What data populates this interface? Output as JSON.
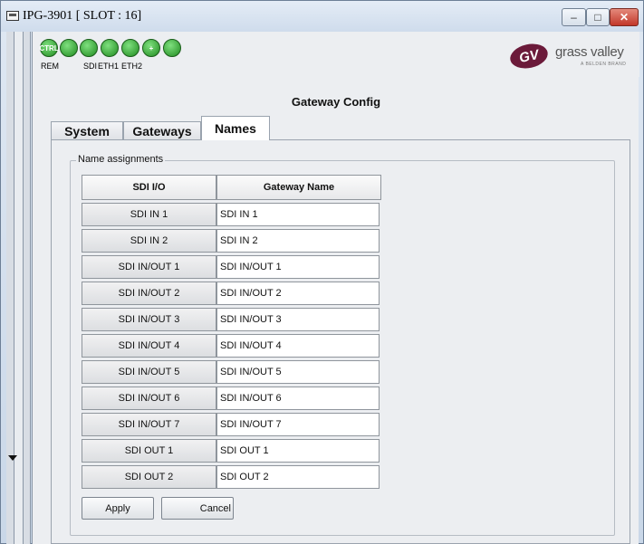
{
  "window": {
    "title": "IPG-3901   [ SLOT : 16]",
    "minimize_glyph": "–",
    "maximize_glyph": "□",
    "close_glyph": "✕"
  },
  "status_icons": [
    {
      "name": "ctrl-icon",
      "glyph": "CTRL",
      "label": "REM"
    },
    {
      "name": "link-icon",
      "glyph": "",
      "label": ""
    },
    {
      "name": "sdi-icon",
      "glyph": "",
      "label": "SDI"
    },
    {
      "name": "eth1-icon",
      "glyph": "",
      "label": "ETH1"
    },
    {
      "name": "eth2-icon",
      "glyph": "",
      "label": "ETH2"
    },
    {
      "name": "plus-icon",
      "glyph": "+",
      "label": ""
    },
    {
      "name": "arrow-icon",
      "glyph": "",
      "label": ""
    }
  ],
  "logo": {
    "mark": "GV",
    "text": "grass valley",
    "sub": "A BELDEN BRAND"
  },
  "page_title": "Gateway Config",
  "tabs": {
    "system": "System",
    "gateways": "Gateways",
    "names": "Names"
  },
  "name_assignments": {
    "legend": "Name assignments",
    "col_io": "SDI I/O",
    "col_name": "Gateway Name",
    "rows": [
      {
        "io": "SDI IN 1",
        "name": "SDI IN 1"
      },
      {
        "io": "SDI IN 2",
        "name": "SDI IN 2"
      },
      {
        "io": "SDI IN/OUT 1",
        "name": "SDI IN/OUT 1"
      },
      {
        "io": "SDI IN/OUT 2",
        "name": "SDI IN/OUT 2"
      },
      {
        "io": "SDI IN/OUT 3",
        "name": "SDI IN/OUT 3"
      },
      {
        "io": "SDI IN/OUT 4",
        "name": "SDI IN/OUT 4"
      },
      {
        "io": "SDI IN/OUT 5",
        "name": "SDI IN/OUT 5"
      },
      {
        "io": "SDI IN/OUT 6",
        "name": "SDI IN/OUT 6"
      },
      {
        "io": "SDI IN/OUT 7",
        "name": "SDI IN/OUT 7"
      },
      {
        "io": "SDI OUT 1",
        "name": "SDI OUT 1"
      },
      {
        "io": "SDI OUT 2",
        "name": "SDI OUT 2"
      }
    ]
  },
  "buttons": {
    "apply": "Apply",
    "cancel": "Cancel"
  },
  "colors": {
    "status_ok": "#1f8a1f",
    "logo_brand": "#6b1a3a",
    "close_button": "#c2382a"
  }
}
